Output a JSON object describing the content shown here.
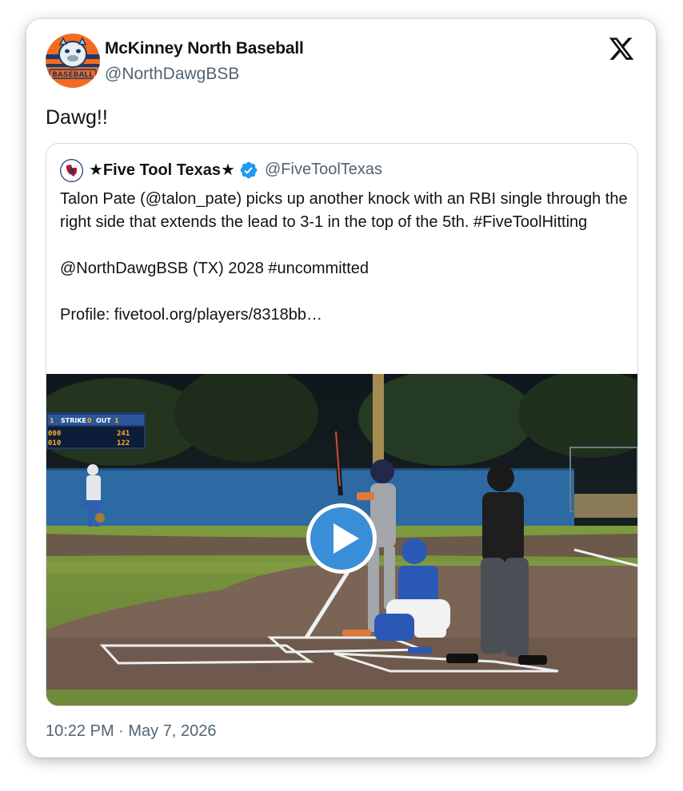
{
  "author": {
    "name": "McKinney North Baseball",
    "handle": "@NorthDawgBSB",
    "avatar_icon": "bulldog-baseball-logo",
    "avatar_text": "BASEBALL"
  },
  "platform_icon": "x-logo-icon",
  "tweet_text": "Dawg!!",
  "quoted": {
    "name": "★Five Tool Texas★",
    "handle": "@FiveToolTexas",
    "verified": true,
    "verified_color": "#1d9bf0",
    "text": "Talon Pate (@talon_pate) picks up another knock with an RBI single through the right side that extends the lead to 3-1 in the top of the 5th. #FiveToolHitting\n\n@NorthDawgBSB (TX) 2028 #uncommitted\n\nProfile: fivetool.org/players/8318bb…",
    "video": {
      "description_icon": "baseball-video-thumbnail",
      "scoreboard": {
        "strike_label": "STRIKE",
        "out_label": "OUT",
        "strike_value": "0",
        "out_value": "1",
        "row1": "000",
        "row2": "010",
        "right_row1": "241",
        "right_row2": "122",
        "left_digit": "1"
      },
      "play_color": "#3a8ed8"
    }
  },
  "timestamp": "10:22 PM · May 7, 2026"
}
